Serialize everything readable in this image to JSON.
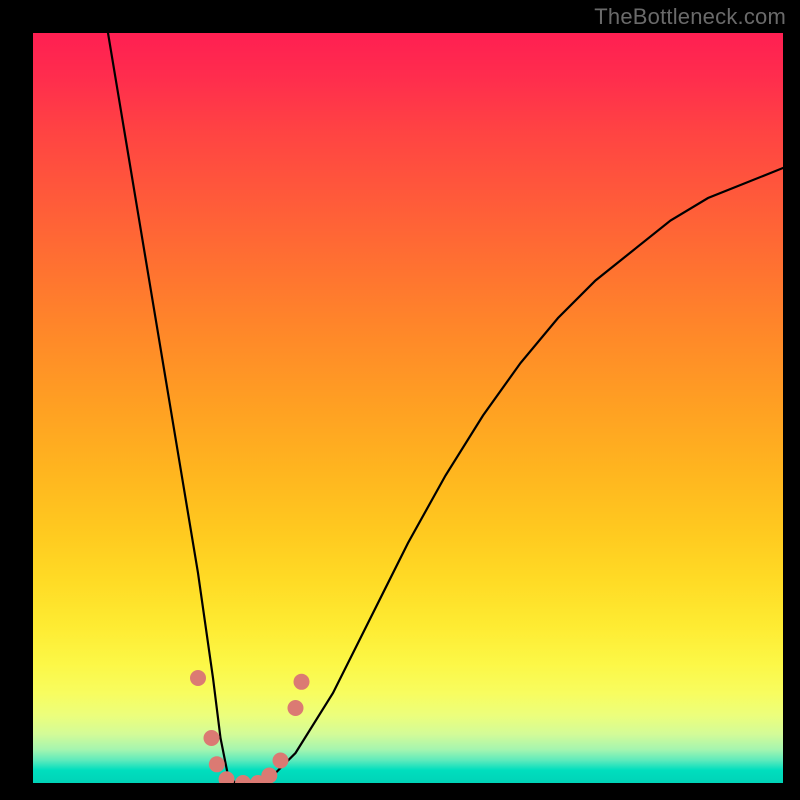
{
  "watermark": "TheBottleneck.com",
  "chart_data": {
    "type": "line",
    "title": "",
    "xlabel": "",
    "ylabel": "",
    "xlim": [
      0,
      100
    ],
    "ylim": [
      0,
      100
    ],
    "series": [
      {
        "name": "bottleneck-curve",
        "x": [
          10,
          12,
          14,
          16,
          18,
          20,
          22,
          24,
          25,
          26,
          27,
          28,
          30,
          32,
          35,
          40,
          45,
          50,
          55,
          60,
          65,
          70,
          75,
          80,
          85,
          90,
          95,
          100
        ],
        "y": [
          100,
          88,
          76,
          64,
          52,
          40,
          28,
          14,
          6,
          1,
          0,
          0,
          0,
          1,
          4,
          12,
          22,
          32,
          41,
          49,
          56,
          62,
          67,
          71,
          75,
          78,
          80,
          82
        ]
      }
    ],
    "markers": [
      {
        "name": "left-upper-dot",
        "x": 22.0,
        "y": 14.0
      },
      {
        "name": "left-mid-dot",
        "x": 23.8,
        "y": 6.0
      },
      {
        "name": "left-low-dot",
        "x": 24.5,
        "y": 2.5
      },
      {
        "name": "left-bottom-dot",
        "x": 25.8,
        "y": 0.5
      },
      {
        "name": "valley-dot-1",
        "x": 28.0,
        "y": 0.0
      },
      {
        "name": "valley-dot-2",
        "x": 30.0,
        "y": 0.0
      },
      {
        "name": "right-low-dot",
        "x": 31.5,
        "y": 1.0
      },
      {
        "name": "right-mid-dot",
        "x": 33.0,
        "y": 3.0
      },
      {
        "name": "right-upper-1",
        "x": 35.0,
        "y": 10.0
      },
      {
        "name": "right-upper-2",
        "x": 35.8,
        "y": 13.5
      }
    ],
    "colors": {
      "curve": "#000000",
      "marker": "#db7a73",
      "gradient_top": "#ff1f52",
      "gradient_bottom": "#00d3b7"
    }
  }
}
